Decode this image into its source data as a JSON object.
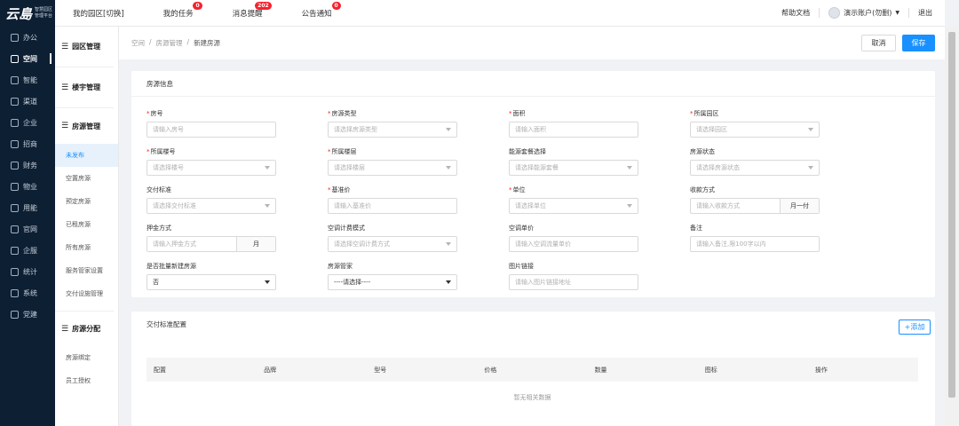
{
  "app": {
    "logo_text": "云島",
    "logo_sub1": "智慧园区",
    "logo_sub2": "管理平台"
  },
  "leftnav": {
    "items": [
      {
        "label": "办公",
        "icon": "office-icon"
      },
      {
        "label": "空间",
        "icon": "space-icon"
      },
      {
        "label": "智能",
        "icon": "smart-icon"
      },
      {
        "label": "渠道",
        "icon": "channel-icon"
      },
      {
        "label": "企业",
        "icon": "enterprise-icon"
      },
      {
        "label": "招商",
        "icon": "investment-icon"
      },
      {
        "label": "财务",
        "icon": "finance-icon"
      },
      {
        "label": "物业",
        "icon": "property-icon"
      },
      {
        "label": "用能",
        "icon": "energy-icon"
      },
      {
        "label": "官网",
        "icon": "website-icon"
      },
      {
        "label": "企服",
        "icon": "service-icon"
      },
      {
        "label": "统计",
        "icon": "stats-icon"
      },
      {
        "label": "系统",
        "icon": "system-icon"
      },
      {
        "label": "党建",
        "icon": "party-icon"
      }
    ],
    "active": "空间"
  },
  "topbar": {
    "tabs": [
      {
        "label": "我的园区[切换]",
        "badge": ""
      },
      {
        "label": "我的任务",
        "badge": "0"
      },
      {
        "label": "消息提醒",
        "badge": "202"
      },
      {
        "label": "公告通知",
        "badge": "0"
      }
    ],
    "help": "帮助文档",
    "user": "演示账户(勿删)",
    "logout": "退出"
  },
  "subnav": {
    "group1": "园区管理",
    "group2": "楼宇管理",
    "group3": "房源管理",
    "group3_items": [
      "未发布",
      "空置房源",
      "预定房源",
      "已租房源",
      "所有房源",
      "服务管家设置",
      "交付设施管理"
    ],
    "group4": "房源分配",
    "group4_items": [
      "房源绑定",
      "员工授权"
    ]
  },
  "breadcrumb": {
    "c1": "空间",
    "c2": "房源管理",
    "c3": "新建房源"
  },
  "buttons": {
    "cancel": "取消",
    "save": "保存",
    "add": "+添加"
  },
  "form": {
    "title": "房源信息",
    "f_room_no": {
      "label": "房号",
      "placeholder": "请输入房号"
    },
    "f_type": {
      "label": "房源类型",
      "placeholder": "请选择房源类型"
    },
    "f_area": {
      "label": "面积",
      "placeholder": "请输入面积"
    },
    "f_park": {
      "label": "所属园区",
      "placeholder": "请选择园区"
    },
    "f_building": {
      "label": "所属楼号",
      "placeholder": "请选择楼号"
    },
    "f_floor": {
      "label": "所属楼层",
      "placeholder": "请选择楼层"
    },
    "f_energy": {
      "label": "能源套餐选择",
      "placeholder": "请选择能源套餐"
    },
    "f_status": {
      "label": "房源状态",
      "placeholder": "请选择房源状态"
    },
    "f_delivery": {
      "label": "交付标准",
      "placeholder": "请选择交付标准"
    },
    "f_base_price": {
      "label": "基准价",
      "placeholder": "请输入基准价"
    },
    "f_unit": {
      "label": "单位",
      "placeholder": "请选择单位"
    },
    "f_payment": {
      "label": "收款方式",
      "placeholder": "请输入收款方式",
      "addon": "月一付"
    },
    "f_deposit": {
      "label": "押金方式",
      "placeholder": "请输入押金方式",
      "addon": "月"
    },
    "f_ac_mode": {
      "label": "空调计费模式",
      "placeholder": "请选择空调计费方式"
    },
    "f_ac_price": {
      "label": "空调单价",
      "placeholder": "请输入空调流量单价"
    },
    "f_remark": {
      "label": "备注",
      "placeholder": "请输入备注,限100字以内"
    },
    "f_batch": {
      "label": "是否批量新建房源",
      "value": "否"
    },
    "f_butler": {
      "label": "房源管家",
      "value": "----请选择----"
    },
    "f_image": {
      "label": "图片链接",
      "placeholder": "请输入图片链接地址"
    }
  },
  "delivery_config": {
    "title": "交付标准配置",
    "columns": [
      "配置",
      "品牌",
      "型号",
      "价格",
      "数量",
      "图标",
      "操作"
    ],
    "empty": "暂无相关数据"
  }
}
